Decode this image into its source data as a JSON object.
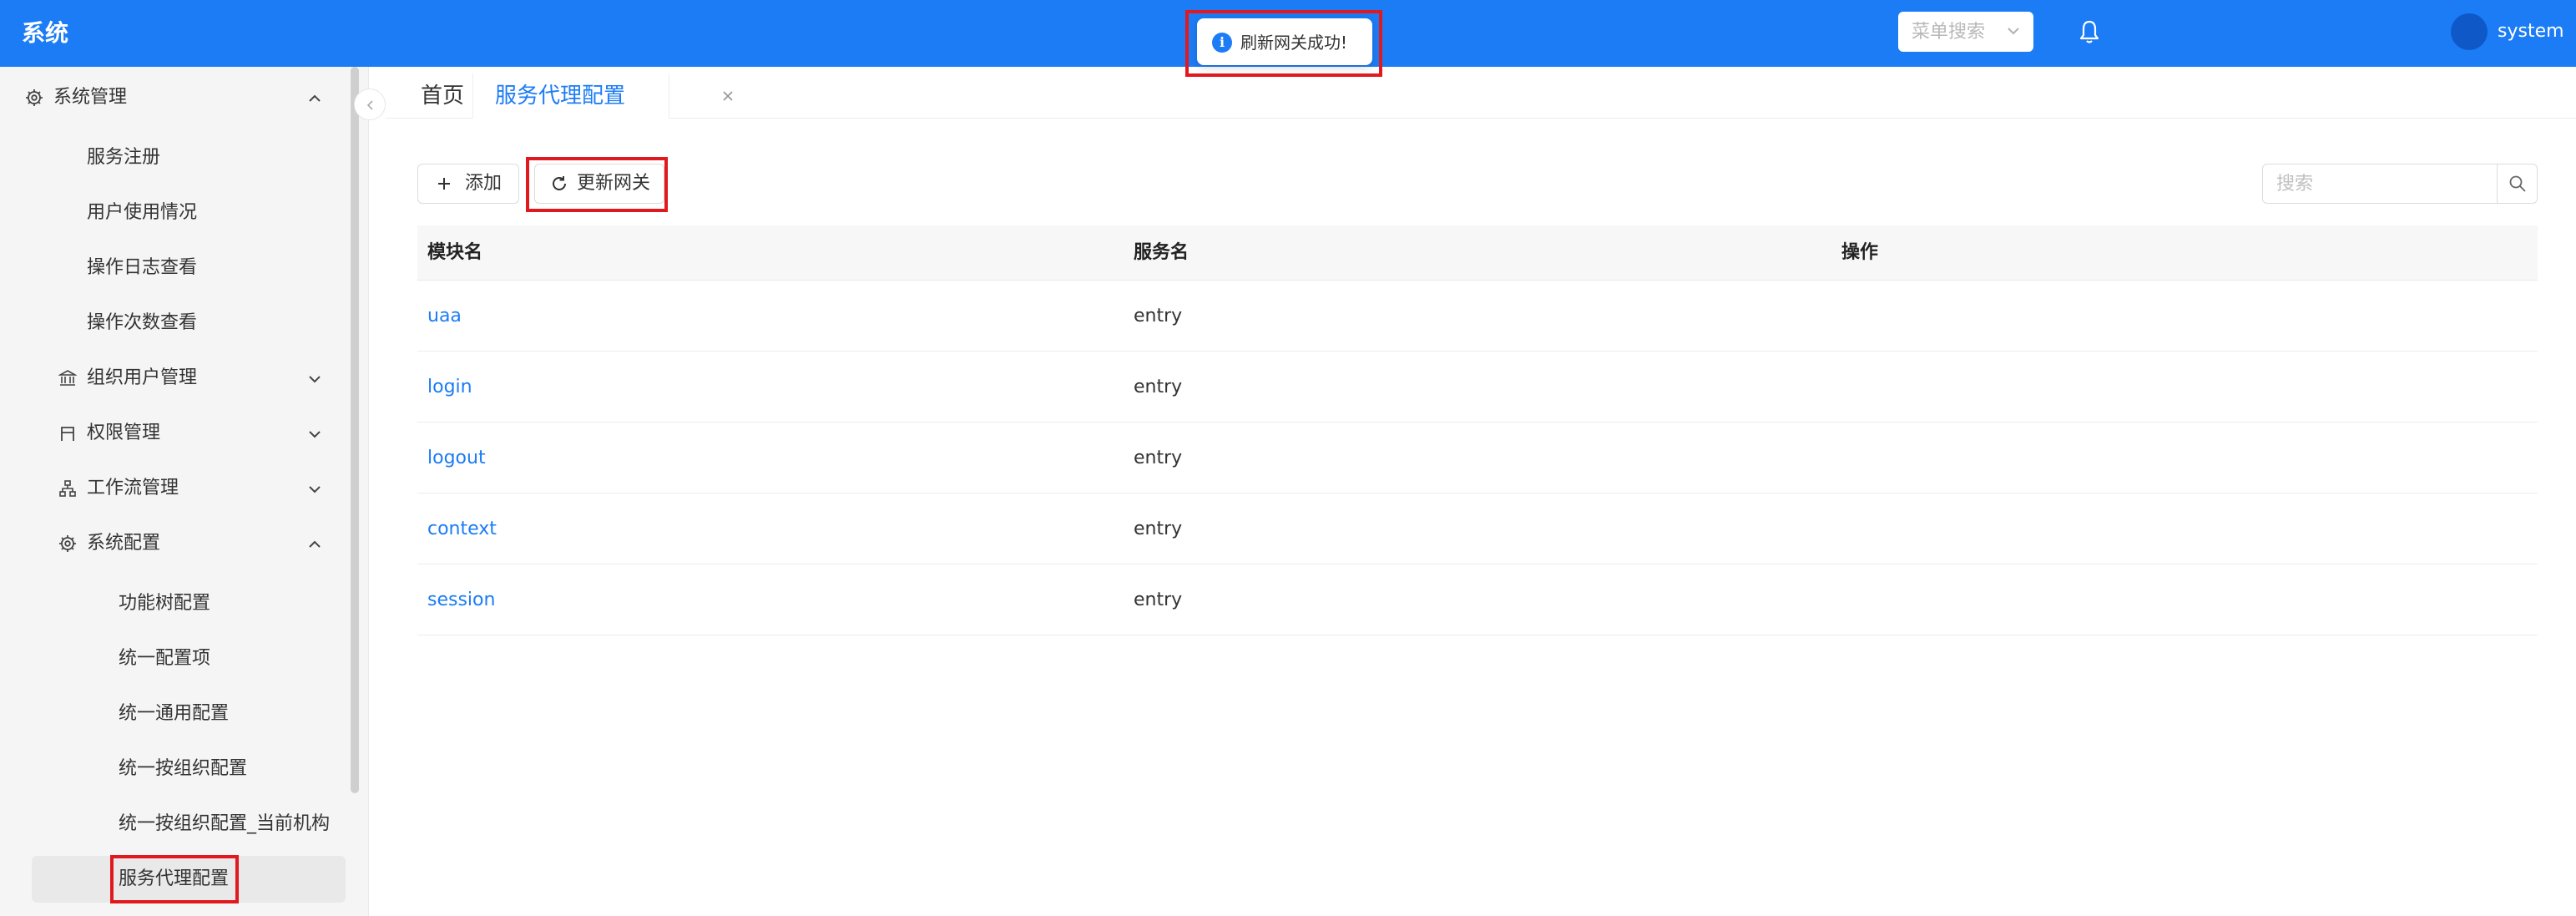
{
  "header": {
    "app_title": "系统",
    "menu_search_placeholder": "菜单搜索",
    "username": "system"
  },
  "toast": {
    "message": "刷新网关成功!",
    "icon": "info-icon"
  },
  "sidebar": {
    "items": [
      {
        "label": "系统管理",
        "icon": "gear-icon",
        "expanded": true
      },
      {
        "label": "服务注册"
      },
      {
        "label": "用户使用情况"
      },
      {
        "label": "操作日志查看"
      },
      {
        "label": "操作次数查看"
      },
      {
        "label": "组织用户管理",
        "icon": "bank-icon",
        "expanded": false
      },
      {
        "label": "权限管理",
        "icon": "gate-icon",
        "expanded": false
      },
      {
        "label": "工作流管理",
        "icon": "flow-icon",
        "expanded": false
      },
      {
        "label": "系统配置",
        "icon": "gear-icon",
        "expanded": true
      },
      {
        "label": "功能树配置"
      },
      {
        "label": "统一配置项"
      },
      {
        "label": "统一通用配置"
      },
      {
        "label": "统一按组织配置"
      },
      {
        "label": "统一按组织配置_当前机构"
      },
      {
        "label": "服务代理配置",
        "active": true
      }
    ]
  },
  "tabs": [
    {
      "label": "首页"
    },
    {
      "label": "服务代理配置",
      "active": true,
      "closable": true
    }
  ],
  "toolbar": {
    "add_label": "添加",
    "refresh_label": "更新网关",
    "search_placeholder": "搜索"
  },
  "table": {
    "columns": [
      "模块名",
      "服务名",
      "操作"
    ],
    "rows": [
      {
        "module": "uaa",
        "service": "entry"
      },
      {
        "module": "login",
        "service": "entry"
      },
      {
        "module": "logout",
        "service": "entry"
      },
      {
        "module": "context",
        "service": "entry"
      },
      {
        "module": "session",
        "service": "entry"
      }
    ]
  },
  "colors": {
    "primary": "#1c7cf5",
    "highlight_outline": "#e0191f",
    "sidebar_bg": "#f5f5f5"
  }
}
